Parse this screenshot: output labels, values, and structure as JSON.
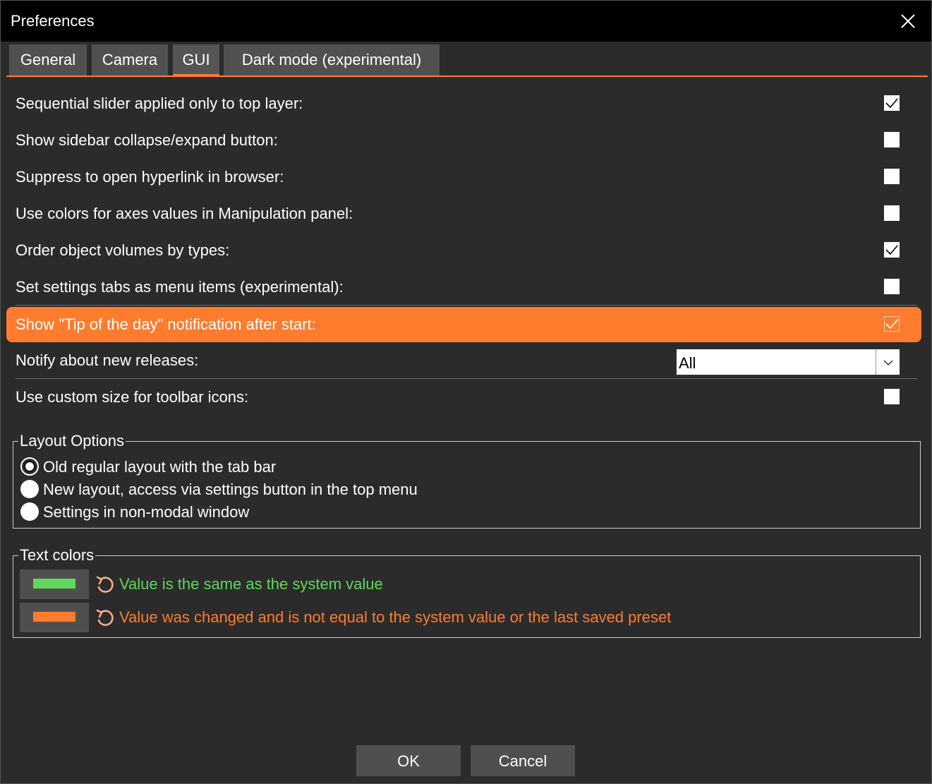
{
  "window": {
    "title": "Preferences"
  },
  "tabs": [
    {
      "label": "General"
    },
    {
      "label": "Camera"
    },
    {
      "label": "GUI"
    },
    {
      "label": "Dark mode (experimental)"
    }
  ],
  "active_tab": "GUI",
  "settings": [
    {
      "label": "Sequential slider applied only to top layer:",
      "checked": true
    },
    {
      "label": "Show sidebar collapse/expand button:",
      "checked": false
    },
    {
      "label": "Suppress to open hyperlink in browser:",
      "checked": false
    },
    {
      "label": "Use colors for axes values in Manipulation panel:",
      "checked": false
    },
    {
      "label": "Order object volumes by types:",
      "checked": true
    },
    {
      "label": "Set settings tabs as menu items (experimental):",
      "checked": false
    },
    {
      "label": "Show \"Tip of the day\" notification after start:",
      "checked": true
    },
    {
      "label": "Notify about new releases:",
      "select_value": "All"
    },
    {
      "label": "Use custom size for toolbar icons:",
      "checked": false
    }
  ],
  "layout_options": {
    "title": "Layout Options",
    "options": [
      {
        "label": "Old regular layout with the tab bar",
        "selected": true
      },
      {
        "label": "New layout, access via settings button in the top menu",
        "selected": false
      },
      {
        "label": "Settings in non-modal window",
        "selected": false
      }
    ]
  },
  "text_colors": {
    "title": "Text colors",
    "items": [
      {
        "label": "Value is the same as the system value",
        "color": "#63d75a"
      },
      {
        "label": "Value was changed and is not equal to the system value or the last saved preset",
        "color": "#ff7b2d"
      }
    ]
  },
  "buttons": {
    "ok": "OK",
    "cancel": "Cancel"
  },
  "colors": {
    "accent": "#ff7b2d",
    "background": "#2b2b2b",
    "titlebar": "#000000",
    "system_value": "#63d75a",
    "changed_value": "#ff7b2d"
  }
}
